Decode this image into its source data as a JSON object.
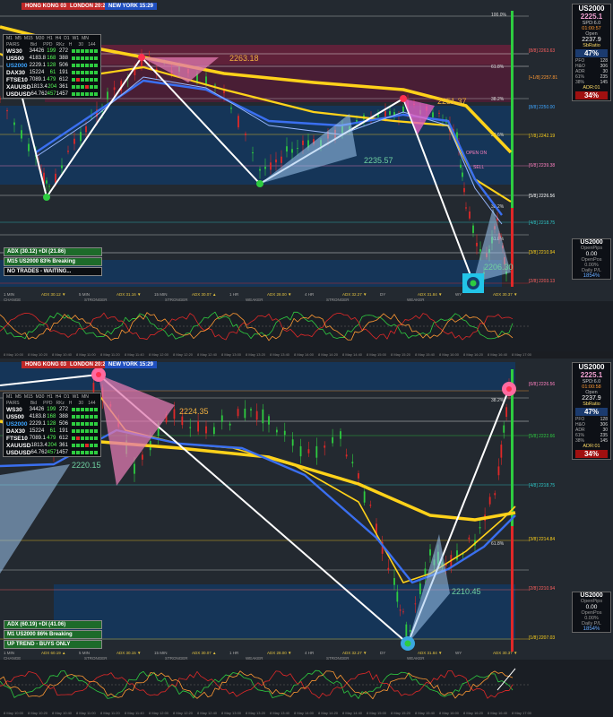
{
  "sessions": {
    "hongkong": "HONG KONG 03:29",
    "london": "LONDON 20:29",
    "newyork": "NEW YORK 15:29"
  },
  "stats_box": {
    "timeframes": [
      "M1",
      "M5",
      "M15",
      "M30",
      "H1",
      "H4",
      "D1",
      "W1",
      "MN"
    ],
    "headers": [
      "PAIRS",
      "Bid",
      "PPD",
      "RKz",
      "H",
      "30",
      "144"
    ],
    "rows": [
      {
        "sym": "WS30",
        "bid": "34426",
        "ppd": "199",
        "rkz": "272",
        "color": "#ffffff"
      },
      {
        "sym": "US500",
        "bid": "4183.8",
        "ppd": "168",
        "rkz": "388",
        "color": "#ffffff"
      },
      {
        "sym": "US2000",
        "bid": "2229.1",
        "ppd": "128",
        "rkz": "506",
        "color": "#3da5ff"
      },
      {
        "sym": "DAX30",
        "bid": "15224",
        "ppd": "61",
        "rkz": "191",
        "color": "#ffffff"
      },
      {
        "sym": "FTSE10",
        "bid": "7089.1",
        "ppd": "479",
        "rkz": "612",
        "color": "#ffffff"
      },
      {
        "sym": "XAUUSD",
        "bid": "1813.4",
        "ppd": "204",
        "rkz": "361",
        "color": "#ffffff"
      },
      {
        "sym": "USDUSD",
        "bid": "64.762",
        "ppd": "457",
        "rkz": "1457",
        "color": "#ffffff"
      }
    ]
  },
  "top": {
    "info": [
      "ADX (30.12) +DI (21.86)",
      "M15 US2000 83% Breaking",
      "NO TRADES - WAITING..."
    ],
    "panel": {
      "symbol": "US2000",
      "price": "2225.1",
      "spd": "SPD:6.0",
      "timer": "01:00:57",
      "open_lbl": "Open",
      "open_val": "2237.9",
      "sbr": "SbRatio",
      "pct": "47%",
      "ratio": "34%",
      "adr": "ADR:01",
      "kv": [
        [
          "PFO",
          "128"
        ],
        [
          "H&O",
          "306"
        ],
        [
          "ADR",
          "30"
        ],
        [
          "61%",
          "235"
        ],
        [
          "38%",
          "145"
        ]
      ]
    },
    "pips": {
      "title": "US2000",
      "open_lbl": "OpenPips",
      "open_val": "0.00",
      "open_pos": "OpenPos",
      "pos_val": "0.00%",
      "daily_lbl": "Daily P/L",
      "daily_val": "1854%"
    },
    "callouts": [
      "2263.18",
      "2251.37",
      "2235.57",
      "2206.30"
    ],
    "pct_labels": [
      "100.0%",
      "61.8%",
      "38.2%",
      "23.6%",
      "38.2%",
      "61.8%"
    ],
    "murrey": [
      "[8/8]",
      "[+1/8]",
      "[8/8]",
      "[7/8]",
      "[6/8]",
      "[5/8]",
      "[4/8]",
      "[3/8]",
      "[2/8]"
    ],
    "murrey_vals": [
      "2263.63",
      "2257.81",
      "2250.00",
      "2242.19",
      "2239.38",
      "2226.56",
      "2218.75",
      "2210.94",
      "2203.13"
    ],
    "open_lbl": "OPEN ON",
    "sell_lbl": "SELL",
    "tf_strip": [
      "1 MIN",
      "ADX 30.12 ▼",
      "5 MIN",
      "ADX 31.16 ▼",
      "15 MIN",
      "ADX 30.07 ▲",
      "1 HR",
      "ADX 28.00 ▼",
      "4 HR",
      "ADX 32.27 ▼",
      "DY",
      "ADX 31.84 ▼",
      "WY",
      "ADX 30.37 ▼"
    ],
    "strength": [
      "CHANGE",
      "STRONGER",
      "STRONGER",
      "WEAKER",
      "STRONGER",
      "WEAKER"
    ]
  },
  "bottom": {
    "info": [
      "ADX (60.19) +DI (41.06)",
      "M1 US2000 86% Breaking",
      "UP TREND - BUYS ONLY"
    ],
    "panel": {
      "symbol": "US2000",
      "price": "2225.1",
      "spd": "SPD:6.0",
      "timer": "01:00:58",
      "open_lbl": "Open",
      "open_val": "2237.9",
      "sbr": "SbRatio",
      "pct": "47%",
      "ratio": "34%",
      "adr": "ADR:01",
      "kv": [
        [
          "PFO",
          "128"
        ],
        [
          "H&O",
          "306"
        ],
        [
          "ADR",
          "30"
        ],
        [
          "61%",
          "235"
        ],
        [
          "38%",
          "145"
        ]
      ]
    },
    "pips": {
      "title": "US2000",
      "open_lbl": "OpenPips",
      "open_val": "0.00",
      "open_pos": "OpenPos",
      "pos_val": "0.00%",
      "daily_lbl": "Daily P/L",
      "daily_val": "1854%"
    },
    "callouts": [
      "2224.35",
      "2220.15",
      "2210.45"
    ],
    "pct_labels": [
      "38.2%",
      "61.8%"
    ],
    "murrey": [
      "[6/8]",
      "[5/8]",
      "[4/8]",
      "[3/8]",
      "[2/8]",
      "[1/8]"
    ],
    "murrey_vals": [
      "2226.56",
      "2222.66",
      "2218.75",
      "2214.84",
      "2210.94",
      "2207.03"
    ],
    "tf_strip": [
      "1 MIN",
      "ADX 60.19 ▲",
      "5 MIN",
      "ADX 30.15 ▼",
      "15 MIN",
      "ADX 30.07 ▲",
      "1 HR",
      "ADX 28.00 ▼",
      "4 HR",
      "ADX 32.27 ▼",
      "DY",
      "ADX 31.84 ▼",
      "WY",
      "ADX 30.37 ▼"
    ],
    "strength": [
      "CHANGE",
      "STRONGER",
      "STRONGER",
      "WEAKER",
      "STRONGER",
      "WEAKER"
    ]
  },
  "colors": {
    "bg": "#232930",
    "yellow": "#ffd21a",
    "blue": "#3a6ff0",
    "green_up": "#2ecc40",
    "red_dn": "#e02828",
    "magenta": "#b0305a",
    "navy": "#123a6a",
    "pink": "#e07ab0",
    "teal": "#2ec8c8"
  },
  "icons": [
    "signal-circle-icon",
    "target-circle-icon"
  ]
}
